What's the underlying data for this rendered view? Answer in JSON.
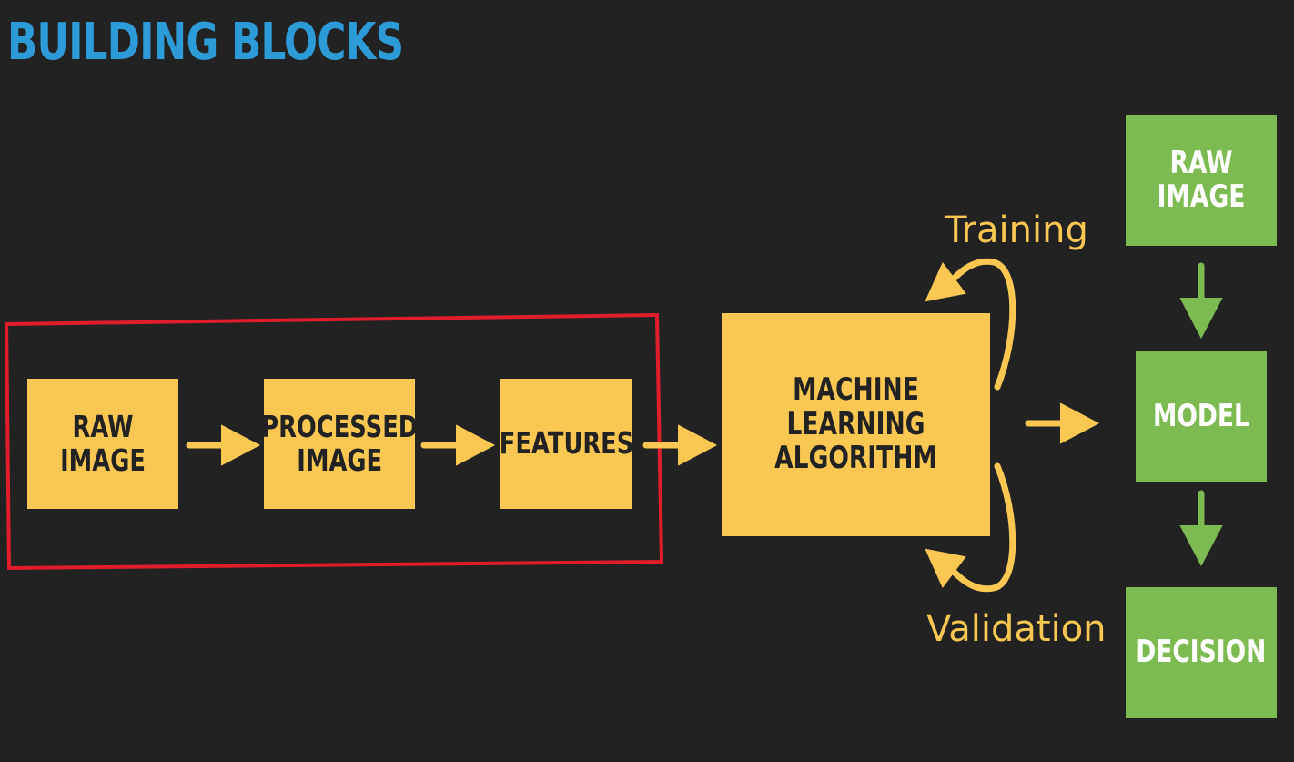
{
  "title": "BUILDING BLOCKS",
  "pipeline": {
    "raw_image": "RAW IMAGE",
    "processed_image": "PROCESSED\nIMAGE",
    "features": "FEATURES",
    "ml_algorithm": "MACHINE LEARNING\nALGORITHM"
  },
  "loop_labels": {
    "training": "Training",
    "validation": "Validation"
  },
  "deployment": {
    "raw_image": "RAW IMAGE",
    "model": "MODEL",
    "decision": "DECISION"
  },
  "colors": {
    "background": "#232223",
    "title": "#2e9bd9",
    "yellow": "#fac852",
    "green": "#7cba52",
    "highlight_frame": "#e11d2c"
  },
  "icons": {
    "pipeline_arrow": "right-arrow-icon",
    "loop_arrow": "curved-arrow-icon",
    "deploy_arrow": "down-arrow-icon"
  }
}
